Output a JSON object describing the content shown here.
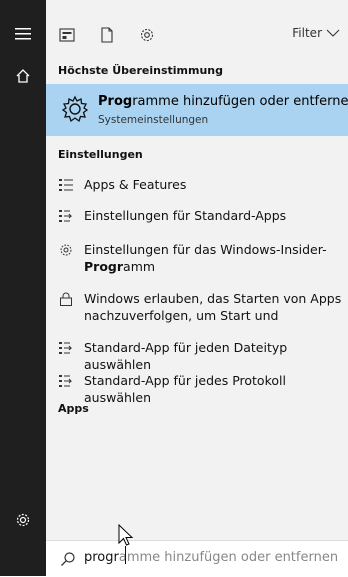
{
  "toolbar": {
    "filter_label": "Filter"
  },
  "sections": {
    "best_match": "Höchste Übereinstimmung",
    "settings": "Einstellungen",
    "apps": "Apps"
  },
  "best_match": {
    "title_bold": "Prog",
    "title_rest": "ramme hinzufügen oder entfernen",
    "subtitle": "Systemeinstellungen"
  },
  "settings_items": [
    {
      "icon": "apps-list-icon",
      "label": "Apps & Features"
    },
    {
      "icon": "default-apps-icon",
      "label": "Einstellungen für Standard-Apps"
    },
    {
      "icon": "gear-icon",
      "label_line1": "Einstellungen für das Windows-Insider-",
      "label_line2_bold": "Progr",
      "label_line2_rest": "amm"
    },
    {
      "icon": "lock-icon",
      "label_line1": "Windows erlauben, das Starten von Apps",
      "label_line2": "nachzuverfolgen, um Start und"
    },
    {
      "icon": "default-apps-icon",
      "label": "Standard-App für jeden Dateityp auswählen"
    },
    {
      "icon": "default-apps-icon",
      "label": "Standard-App für jedes Protokoll auswählen"
    }
  ],
  "search": {
    "typed": "progr",
    "suggestion": "amme hinzufügen oder entfernen"
  }
}
